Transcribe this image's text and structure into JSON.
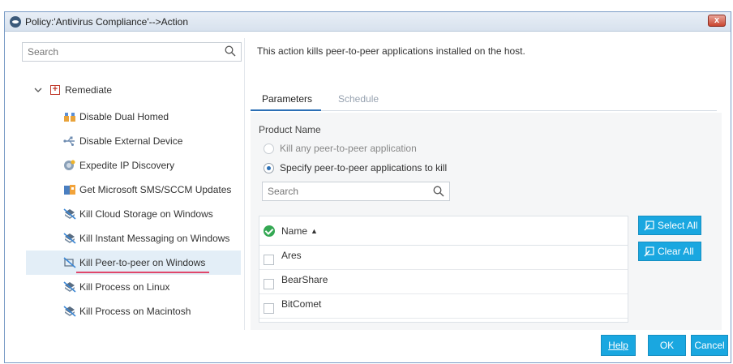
{
  "window": {
    "title": "Policy:'Antivirus Compliance'-->Action",
    "close_label": "x"
  },
  "sidebar": {
    "search_placeholder": "Search",
    "root": {
      "label": "Remediate"
    },
    "items": [
      {
        "label": "Disable Dual Homed",
        "icon": "dual-homed-icon"
      },
      {
        "label": "Disable External Device",
        "icon": "usb-icon"
      },
      {
        "label": "Expedite IP Discovery",
        "icon": "ip-discovery-icon"
      },
      {
        "label": "Get Microsoft SMS/SCCM Updates",
        "icon": "sms-updates-icon"
      },
      {
        "label": "Kill Cloud Storage on Windows",
        "icon": "kill-cloud-icon"
      },
      {
        "label": "Kill Instant Messaging on Windows",
        "icon": "kill-im-icon"
      },
      {
        "label": "Kill Peer-to-peer on Windows",
        "icon": "kill-p2p-icon",
        "selected": true
      },
      {
        "label": "Kill Process on Linux",
        "icon": "kill-process-icon"
      },
      {
        "label": "Kill Process on Macintosh",
        "icon": "kill-process-icon"
      }
    ]
  },
  "main": {
    "description": "This action kills peer-to-peer applications installed on the host.",
    "tabs": [
      {
        "label": "Parameters",
        "active": true
      },
      {
        "label": "Schedule",
        "active": false
      }
    ],
    "product_name_label": "Product Name",
    "radios": [
      {
        "label": "Kill any peer-to-peer application",
        "checked": false
      },
      {
        "label": "Specify peer-to-peer applications to kill",
        "checked": true
      }
    ],
    "search_placeholder": "Search",
    "table": {
      "header": "Name",
      "rows": [
        "Ares",
        "BearShare",
        "BitComet"
      ]
    },
    "select_all_label": "Select All",
    "clear_all_label": "Clear All"
  },
  "footer": {
    "help_label": "Help",
    "ok_label": "OK",
    "cancel_label": "Cancel"
  },
  "colors": {
    "accent": "#1aa7e0",
    "tab_underline": "#2b6fb5",
    "selected_underline": "#e0466a",
    "check": "#34a853"
  }
}
